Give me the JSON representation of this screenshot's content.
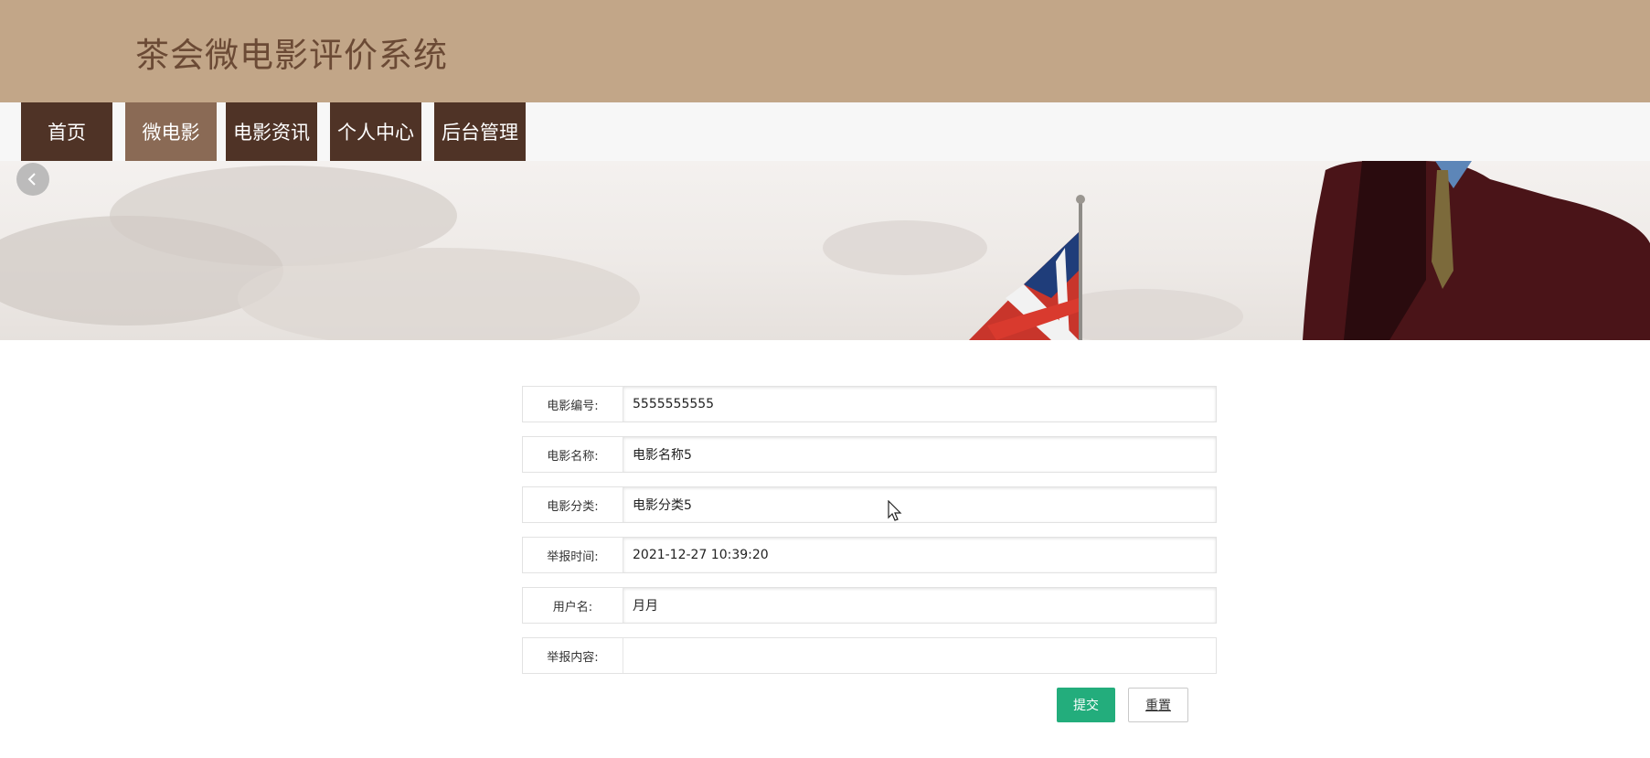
{
  "header": {
    "title": "茶会微电影评价系统"
  },
  "nav": {
    "items": [
      {
        "label": "首页"
      },
      {
        "label": "微电影"
      },
      {
        "label": "电影资讯"
      },
      {
        "label": "个人中心"
      },
      {
        "label": "后台管理"
      }
    ],
    "active_index": 1
  },
  "banner": {
    "prev_icon": "chevron-left-icon"
  },
  "form": {
    "fields": [
      {
        "label": "电影编号:",
        "value": "5555555555"
      },
      {
        "label": "电影名称:",
        "value": "电影名称5"
      },
      {
        "label": "电影分类:",
        "value": "电影分类5"
      },
      {
        "label": "举报时间:",
        "value": "2021-12-27 10:39:20"
      },
      {
        "label": "用户名:",
        "value": "月月"
      },
      {
        "label": "举报内容:",
        "value": ""
      }
    ],
    "submit_label": "提交",
    "reset_label": "重置"
  },
  "colors": {
    "header_bg": "#c2a688",
    "nav_bg": "#4f3326",
    "nav_active_bg": "#8a6a55",
    "submit_bg": "#23ad7c"
  }
}
